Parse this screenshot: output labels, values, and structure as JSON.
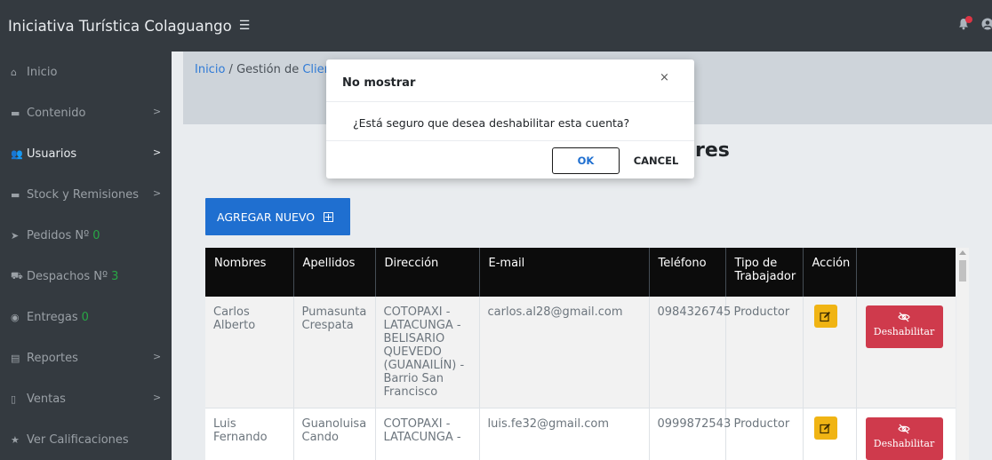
{
  "app": {
    "title": "Iniciativa Turística Colaguango"
  },
  "sidebar": {
    "items": [
      {
        "label": "Inicio",
        "icon": "home-icon"
      },
      {
        "label": "Contenido",
        "icon": "folder-icon"
      },
      {
        "label": "Usuarios",
        "icon": "users-icon"
      },
      {
        "label": "Stock y Remisiones",
        "icon": "folder-icon"
      },
      {
        "label": "Pedidos Nº",
        "count": "0",
        "icon": "paper-plane-icon"
      },
      {
        "label": "Despachos Nº",
        "count": "3",
        "icon": "truck-icon"
      },
      {
        "label": "Entregas",
        "count": "0",
        "icon": "motorcycle-icon"
      },
      {
        "label": "Reportes",
        "icon": "report-icon"
      },
      {
        "label": "Ventas",
        "icon": "tablet-icon"
      },
      {
        "label": "Ver Calificaciones",
        "icon": "star-icon"
      }
    ]
  },
  "breadcrumb": {
    "home": "Inicio",
    "separator": "/",
    "current": "Gestión de",
    "link_fragment": "Clier"
  },
  "page": {
    "heading_fragment": "res"
  },
  "toolbar": {
    "add_label": "AGREGAR NUEVO"
  },
  "table": {
    "headers": [
      "Nombres",
      "Apellidos",
      "Dirección",
      "E-mail",
      "Teléfono",
      "Tipo de Trabajador",
      "Acción"
    ],
    "rows": [
      {
        "nombres": "Carlos Alberto",
        "apellidos": "Pumasunta Crespata",
        "direccion": "COTOPAXI - LATACUNGA - BELISARIO QUEVEDO (GUANAILÍN) - Barrio San Francisco",
        "email": "carlos.al28@gmail.com",
        "telefono": "0984326745",
        "tipo": "Productor",
        "action_label": "Deshabilitar"
      },
      {
        "nombres": "Luis Fernando",
        "apellidos": "Guanoluisa Cando",
        "direccion": "COTOPAXI - LATACUNGA -",
        "email": "luis.fe32@gmail.com",
        "telefono": "0999872543",
        "tipo": "Productor",
        "action_label": "Deshabilitar"
      }
    ]
  },
  "modal": {
    "title": "No mostrar",
    "close": "×",
    "message": "¿Está seguro que desea deshabilitar esta cuenta?",
    "ok_label": "OK",
    "cancel_label": "CANCEL"
  },
  "colors": {
    "sidebar_bg": "#343a40",
    "primary": "#1f6fd0",
    "warning": "#f0b414",
    "danger": "#cf3a4c",
    "success": "#28a745"
  }
}
